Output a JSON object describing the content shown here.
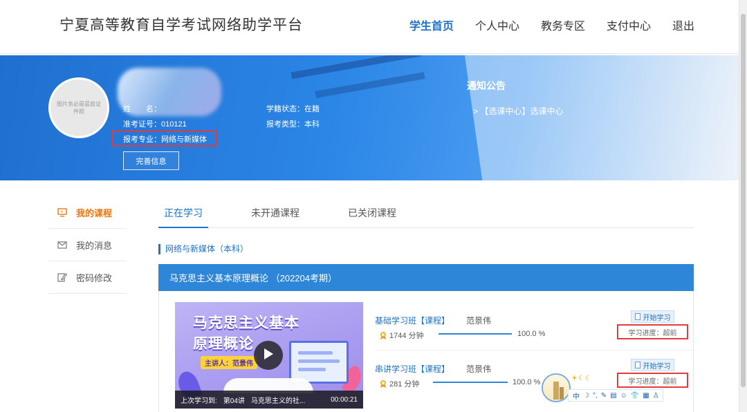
{
  "header": {
    "site_title": "宁夏高等教育自学考试网络助学平台",
    "nav": [
      {
        "label": "学生首页",
        "active": true
      },
      {
        "label": "个人中心",
        "active": false
      },
      {
        "label": "教务专区",
        "active": false
      },
      {
        "label": "支付中心",
        "active": false
      },
      {
        "label": "退出",
        "active": false
      }
    ]
  },
  "profile": {
    "avatar_placeholder": "图片务必是蓝底证件照",
    "name_label": "姓　　名：",
    "name_value": "",
    "exam_id_label": "准考证号：",
    "exam_id_value": "010121",
    "major_label": "报考专业：",
    "major_value": "网络与新媒体",
    "status_label": "学籍状态：",
    "status_value": "在籍",
    "type_label": "报考类型：",
    "type_value": "本科",
    "complete_button": "完善信息"
  },
  "notice": {
    "title": "通知公告",
    "items": [
      "> 【选课中心】选课中心"
    ]
  },
  "sidebar": {
    "items": [
      {
        "label": "我的课程",
        "icon": "monitor-icon",
        "active": true
      },
      {
        "label": "我的消息",
        "icon": "envelope-icon",
        "active": false
      },
      {
        "label": "密码修改",
        "icon": "edit-icon",
        "active": false
      }
    ]
  },
  "tabs": [
    {
      "label": "正在学习",
      "active": true
    },
    {
      "label": "未开通课程",
      "active": false
    },
    {
      "label": "已关闭课程",
      "active": false
    }
  ],
  "section_label": "网络与新媒体（本科）",
  "course": {
    "title": "马克思主义基本原理概论 （202204考期）",
    "thumbnail": {
      "title_line1": "马克思主义基本",
      "title_line2": "原理概论",
      "lecturer": "主讲人：范景伟",
      "caption_prefix": "上次学习到:",
      "caption_lesson": "第04讲",
      "caption_name": "马克思主义的社...",
      "caption_time": "00:00:21"
    },
    "rows": [
      {
        "name": "基础学习班【课程】",
        "teacher": "范景伟",
        "minutes": "1744 分钟",
        "percent": "100.0 %",
        "progress_value": 1.0,
        "start_label": "开始学习",
        "progress_text": "学习进度：超前"
      },
      {
        "name": "串讲学习班【课程】",
        "teacher": "范景伟",
        "minutes": "281 分钟",
        "percent": "100.0 %",
        "progress_value": 1.0,
        "start_label": "开始学习",
        "progress_text": "学习进度：超前"
      }
    ]
  },
  "ime": {
    "weather": "☀☾☾",
    "items": [
      "中",
      "☽",
      "°,",
      "✎",
      "▤",
      "☺",
      "👕",
      "▦",
      "♙"
    ]
  },
  "colors": {
    "accent": "#1d72c9",
    "active_sidebar": "#e87814",
    "course_bar": "#2d86d8",
    "highlight_box": "#e23b3b"
  }
}
